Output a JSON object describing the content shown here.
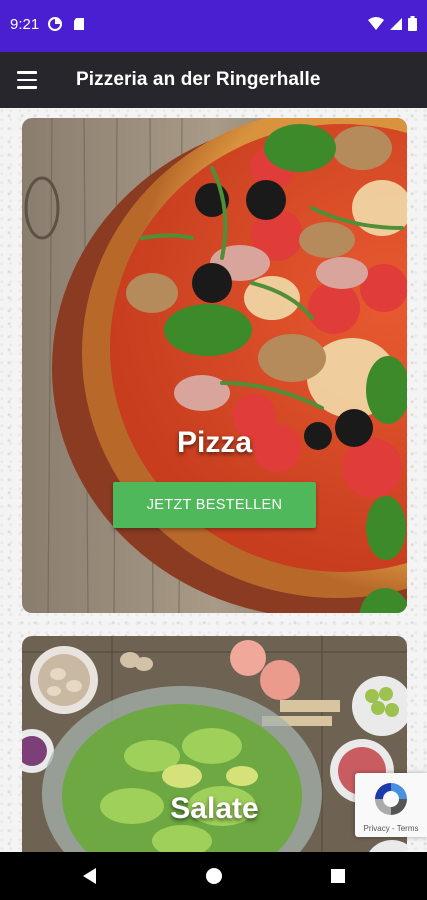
{
  "status_bar": {
    "time": "9:21",
    "background": "#4a1fd1"
  },
  "app_bar": {
    "title": "Pizzeria an der Ringerhalle",
    "menu_icon": "hamburger-menu-icon",
    "background": "#26262c"
  },
  "cards": [
    {
      "title": "Pizza",
      "button_label": "JETZT BESTELLEN"
    },
    {
      "title": "Salate",
      "button_label": ""
    }
  ],
  "colors": {
    "accent_button": "#4fb85a"
  },
  "recaptcha": {
    "links": "Privacy - Terms"
  },
  "nav_bar": {
    "icons": [
      "back-icon",
      "home-icon",
      "recents-icon"
    ]
  }
}
